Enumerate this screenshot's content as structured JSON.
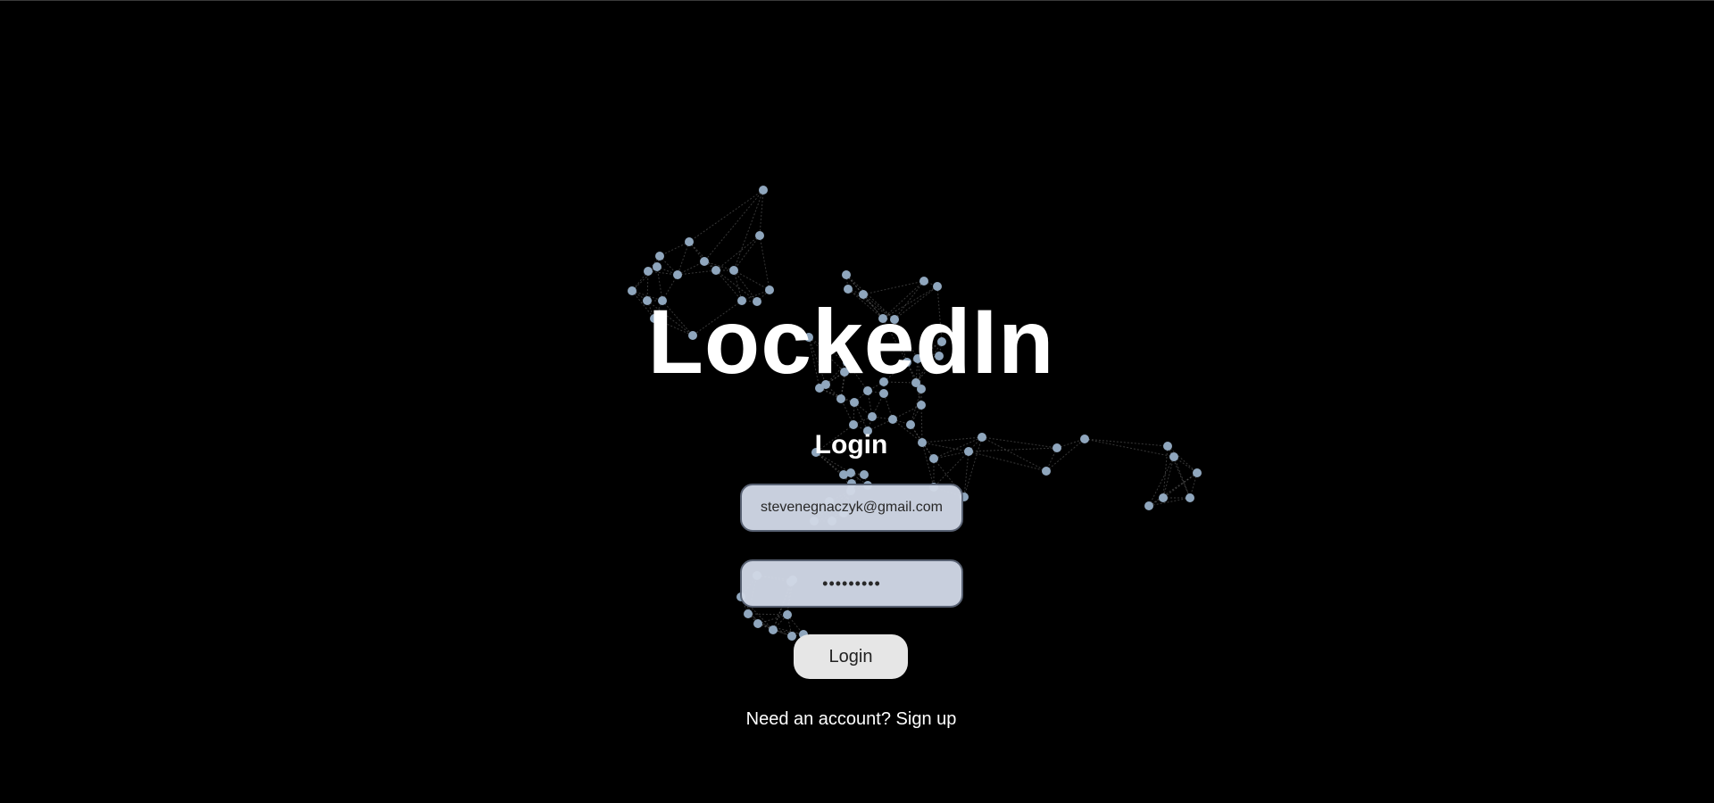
{
  "app": {
    "brand_title": "LockedIn",
    "accent_colors": {
      "background": "#000000",
      "node": "#8fa6bd",
      "input_fill": "#d1d8e6",
      "button_fill": "#e6e6e6"
    }
  },
  "login": {
    "heading": "Login",
    "email_value": "stevenegnaczyk@gmail.com",
    "password_value": "•••••••••",
    "submit_label": "Login",
    "signup_prompt": "Need an account?",
    "signup_link": "Sign up"
  }
}
